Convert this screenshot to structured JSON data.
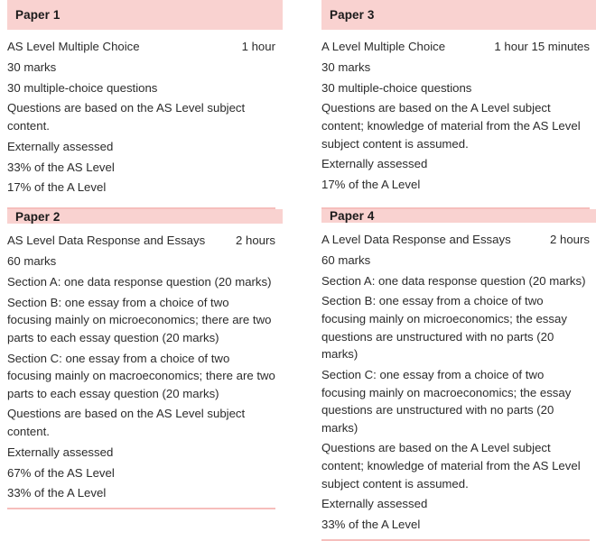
{
  "theme": {
    "band_color": "#f9d2d0",
    "rule_color": "#f6bebc",
    "text_color": "#2b2b2b",
    "heading_color": "#1a1a1a",
    "background": "#ffffff"
  },
  "papers": [
    {
      "heading": "Paper 1",
      "title": "AS Level Multiple Choice",
      "duration": "1 hour",
      "lines": [
        "30 marks",
        "30 multiple-choice questions",
        "Questions are based on the AS Level subject content.",
        "Externally assessed",
        "33% of the AS Level",
        "17% of the A Level"
      ]
    },
    {
      "heading": "Paper 2",
      "title": "AS Level Data Response and Essays",
      "duration": "2 hours",
      "lines": [
        "60 marks",
        "Section A: one data response question (20 marks)",
        "Section B: one essay from a choice of two focusing mainly on microeconomics; there are two parts to each essay question (20 marks)",
        "Section C: one essay from a choice of two focusing mainly on macroeconomics; there are two parts to each essay question (20 marks)",
        "Questions are based on the AS Level subject content.",
        "Externally assessed",
        "67% of the AS Level",
        "33% of the A Level"
      ]
    },
    {
      "heading": "Paper 3",
      "title": "A Level Multiple Choice",
      "duration": "1 hour 15 minutes",
      "lines": [
        "30 marks",
        "30 multiple-choice questions",
        "Questions are based on the A Level subject content; knowledge of material from the AS Level subject content is assumed.",
        "Externally assessed",
        "17% of the A Level"
      ]
    },
    {
      "heading": "Paper 4",
      "title": "A Level Data Response and Essays",
      "duration": "2 hours",
      "lines": [
        "60 marks",
        "Section A: one data response question (20 marks)",
        "Section B: one essay from a choice of two focusing mainly on microeconomics; the essay questions are unstructured with no parts (20 marks)",
        "Section C: one essay from a choice of two focusing mainly on macroeconomics; the essay questions are unstructured with no parts (20 marks)",
        "Questions are based on the A Level subject content; knowledge of material from the AS Level subject content is assumed.",
        "Externally assessed",
        "33% of the A Level"
      ]
    }
  ]
}
